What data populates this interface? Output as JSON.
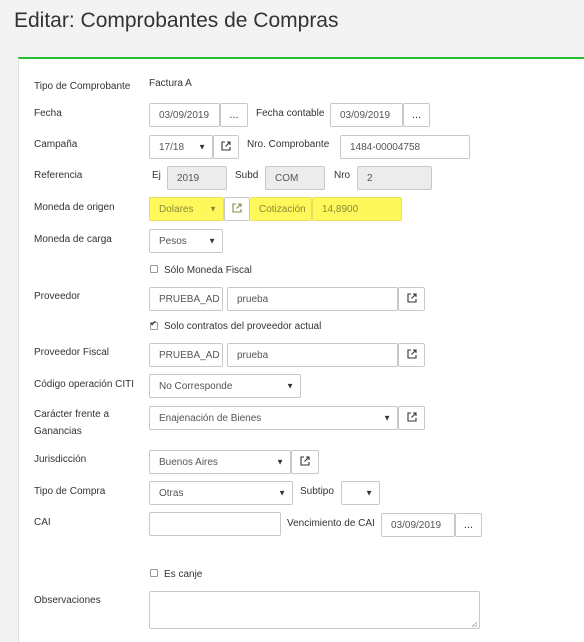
{
  "page": {
    "title": "Editar: Comprobantes de Compras"
  },
  "colors": {
    "accent": "#22c02f",
    "highlight": "#fff85a"
  },
  "form": {
    "tipo_comprobante": {
      "label": "Tipo de Comprobante",
      "value": "Factura A"
    },
    "fecha": {
      "label": "Fecha",
      "value": "03/09/2019",
      "btn": "..."
    },
    "fecha_contable": {
      "label": "Fecha contable",
      "value": "03/09/2019",
      "btn": "..."
    },
    "campana": {
      "label": "Campaña",
      "value": "17/18",
      "icon": "external-link-icon"
    },
    "nro_comprobante": {
      "label": "Nro. Comprobante",
      "value": "1484-00004758"
    },
    "referencia": {
      "label": "Referencia",
      "ej_label": "Ej",
      "ej_value": "2019",
      "subd_label": "Subd",
      "subd_value": "COM",
      "nro_label": "Nro",
      "nro_value": "2"
    },
    "moneda_origen": {
      "label": "Moneda de origen",
      "value": "Dolares",
      "cotizacion_label": "Cotización",
      "cotizacion_value": "14,8900"
    },
    "moneda_carga": {
      "label": "Moneda de carga",
      "value": "Pesos"
    },
    "solo_moneda_fiscal": {
      "label": "Sólo Moneda Fiscal",
      "checked": false
    },
    "proveedor": {
      "label": "Proveedor",
      "code": "PRUEBA_AD",
      "name": "prueba"
    },
    "solo_contratos": {
      "label": "Solo contratos del proveedor actual",
      "checked": true
    },
    "proveedor_fiscal": {
      "label": "Proveedor Fiscal",
      "code": "PRUEBA_AD",
      "name": "prueba"
    },
    "codigo_citi": {
      "label": "Código operación CITI",
      "value": "No Corresponde"
    },
    "caracter_ganancias": {
      "label_line1": "Carácter frente a",
      "label_line2": "Ganancias",
      "value": "Enajenación de Bienes"
    },
    "jurisdiccion": {
      "label": "Jurisdicción",
      "value": "Buenos Aires"
    },
    "tipo_compra": {
      "label": "Tipo de Compra",
      "value": "Otras",
      "subtipo_label": "Subtipo",
      "subtipo_value": ""
    },
    "cai": {
      "label": "CAI",
      "value": "",
      "venc_label": "Vencimiento de CAI",
      "venc_value": "03/09/2019",
      "btn": "..."
    },
    "es_canje": {
      "label": "Es canje",
      "checked": false
    },
    "observaciones": {
      "label": "Observaciones",
      "value": ""
    }
  }
}
